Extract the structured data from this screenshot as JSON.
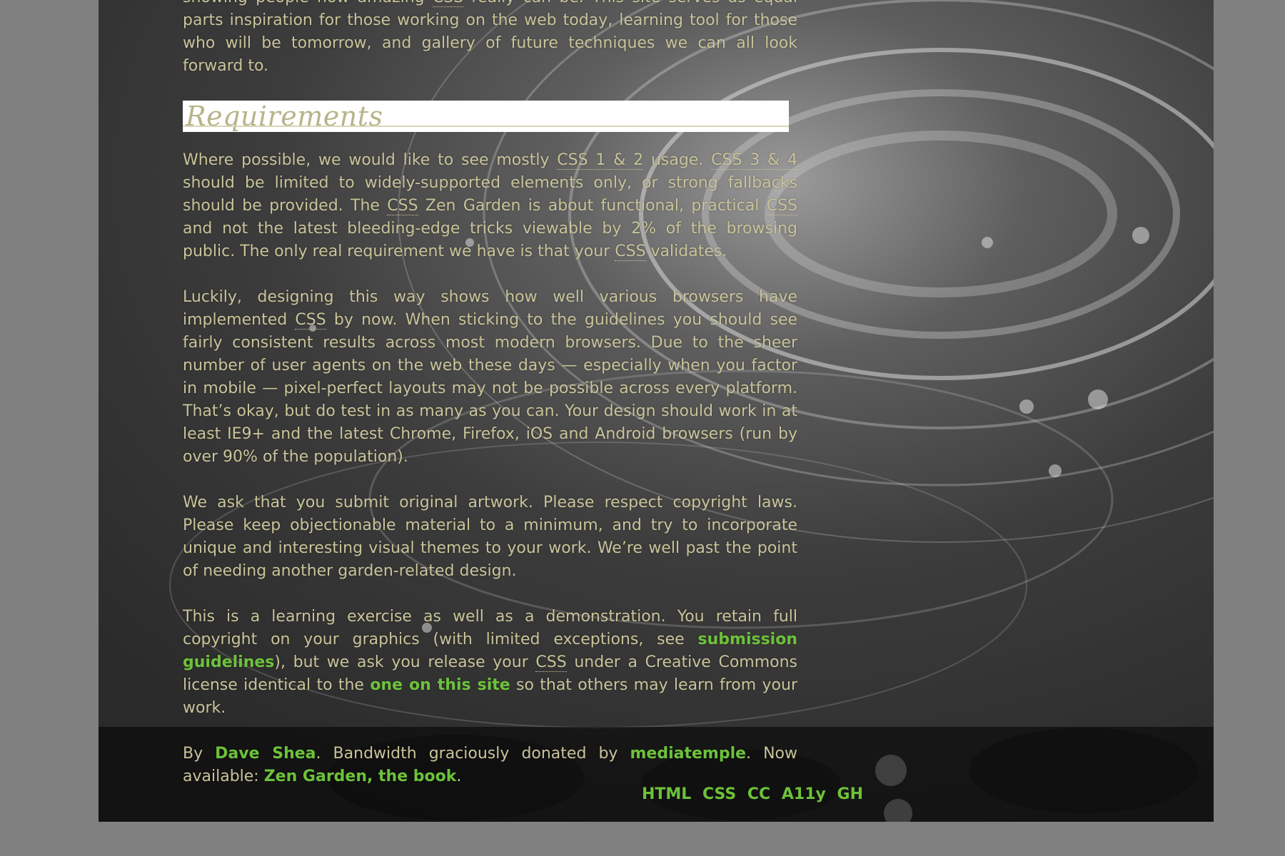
{
  "intro": {
    "line_fragment_1": "showing people how amazing ",
    "abbr": "CSS",
    "line_fragment_2": " really can be. This site serves as equal parts inspiration for those working on the web today, learning tool for those who will be tomorrow, and gallery of future techniques we can all look forward to."
  },
  "requirements": {
    "title": "Requirements",
    "p1": {
      "t1": "Where possible, we would like to see mostly ",
      "a1": "CSS 1 & 2",
      "t2": " usage. ",
      "a2": "CSS 3 & 4",
      "t3": " should be limited to widely-supported elements only, or strong fallbacks should be provided. The ",
      "a3": "CSS",
      "t4": " Zen Garden is about functional, practical ",
      "a4": "CSS",
      "t5": " and not the latest bleeding-edge tricks viewable by 2% of the browsing public. The only real requirement we have is that your ",
      "a5": "CSS",
      "t6": " validates."
    },
    "p2": {
      "t1": "Luckily, designing this way shows how well various browsers have implemented ",
      "a1": "CSS",
      "t2": " by now. When sticking to the guidelines you should see fairly consistent results across most modern browsers. Due to the sheer number of user agents on the web these days — especially when you factor in mobile — pixel-perfect layouts may not be possible across every platform. That’s okay, but do test in as many as you can. Your design should work in at least IE9+ and the latest Chrome, Firefox, iOS and Android browsers (run by over 90% of the population)."
    },
    "p3": "We ask that you submit original artwork. Please respect copyright laws. Please keep objectionable material to a minimum, and try to incorporate unique and interesting visual themes to your work. We’re well past the point of needing another garden-related design.",
    "p4": {
      "t1": "This is a learning exercise as well as a demonstration. You retain full copyright on your graphics (with limited exceptions, see ",
      "link1": "submission guidelines",
      "t2": "), but we ask you release your ",
      "a1": "CSS",
      "t3": " under a Creative Commons license identical to the ",
      "link2": "one on this site",
      "t4": " so that others may learn from your work."
    },
    "p5": {
      "t1": "By ",
      "link1": "Dave Shea",
      "t2": ". Bandwidth graciously donated by ",
      "link2": "mediatemple",
      "t3": ". Now available: ",
      "link3": "Zen Garden, the book",
      "t4": "."
    }
  },
  "footer": {
    "links": [
      "HTML",
      "CSS",
      "CC",
      "A11y",
      "GH"
    ]
  },
  "colors": {
    "text": "#c9c49a",
    "link": "#6dc23a",
    "outer_background": "#808080"
  }
}
